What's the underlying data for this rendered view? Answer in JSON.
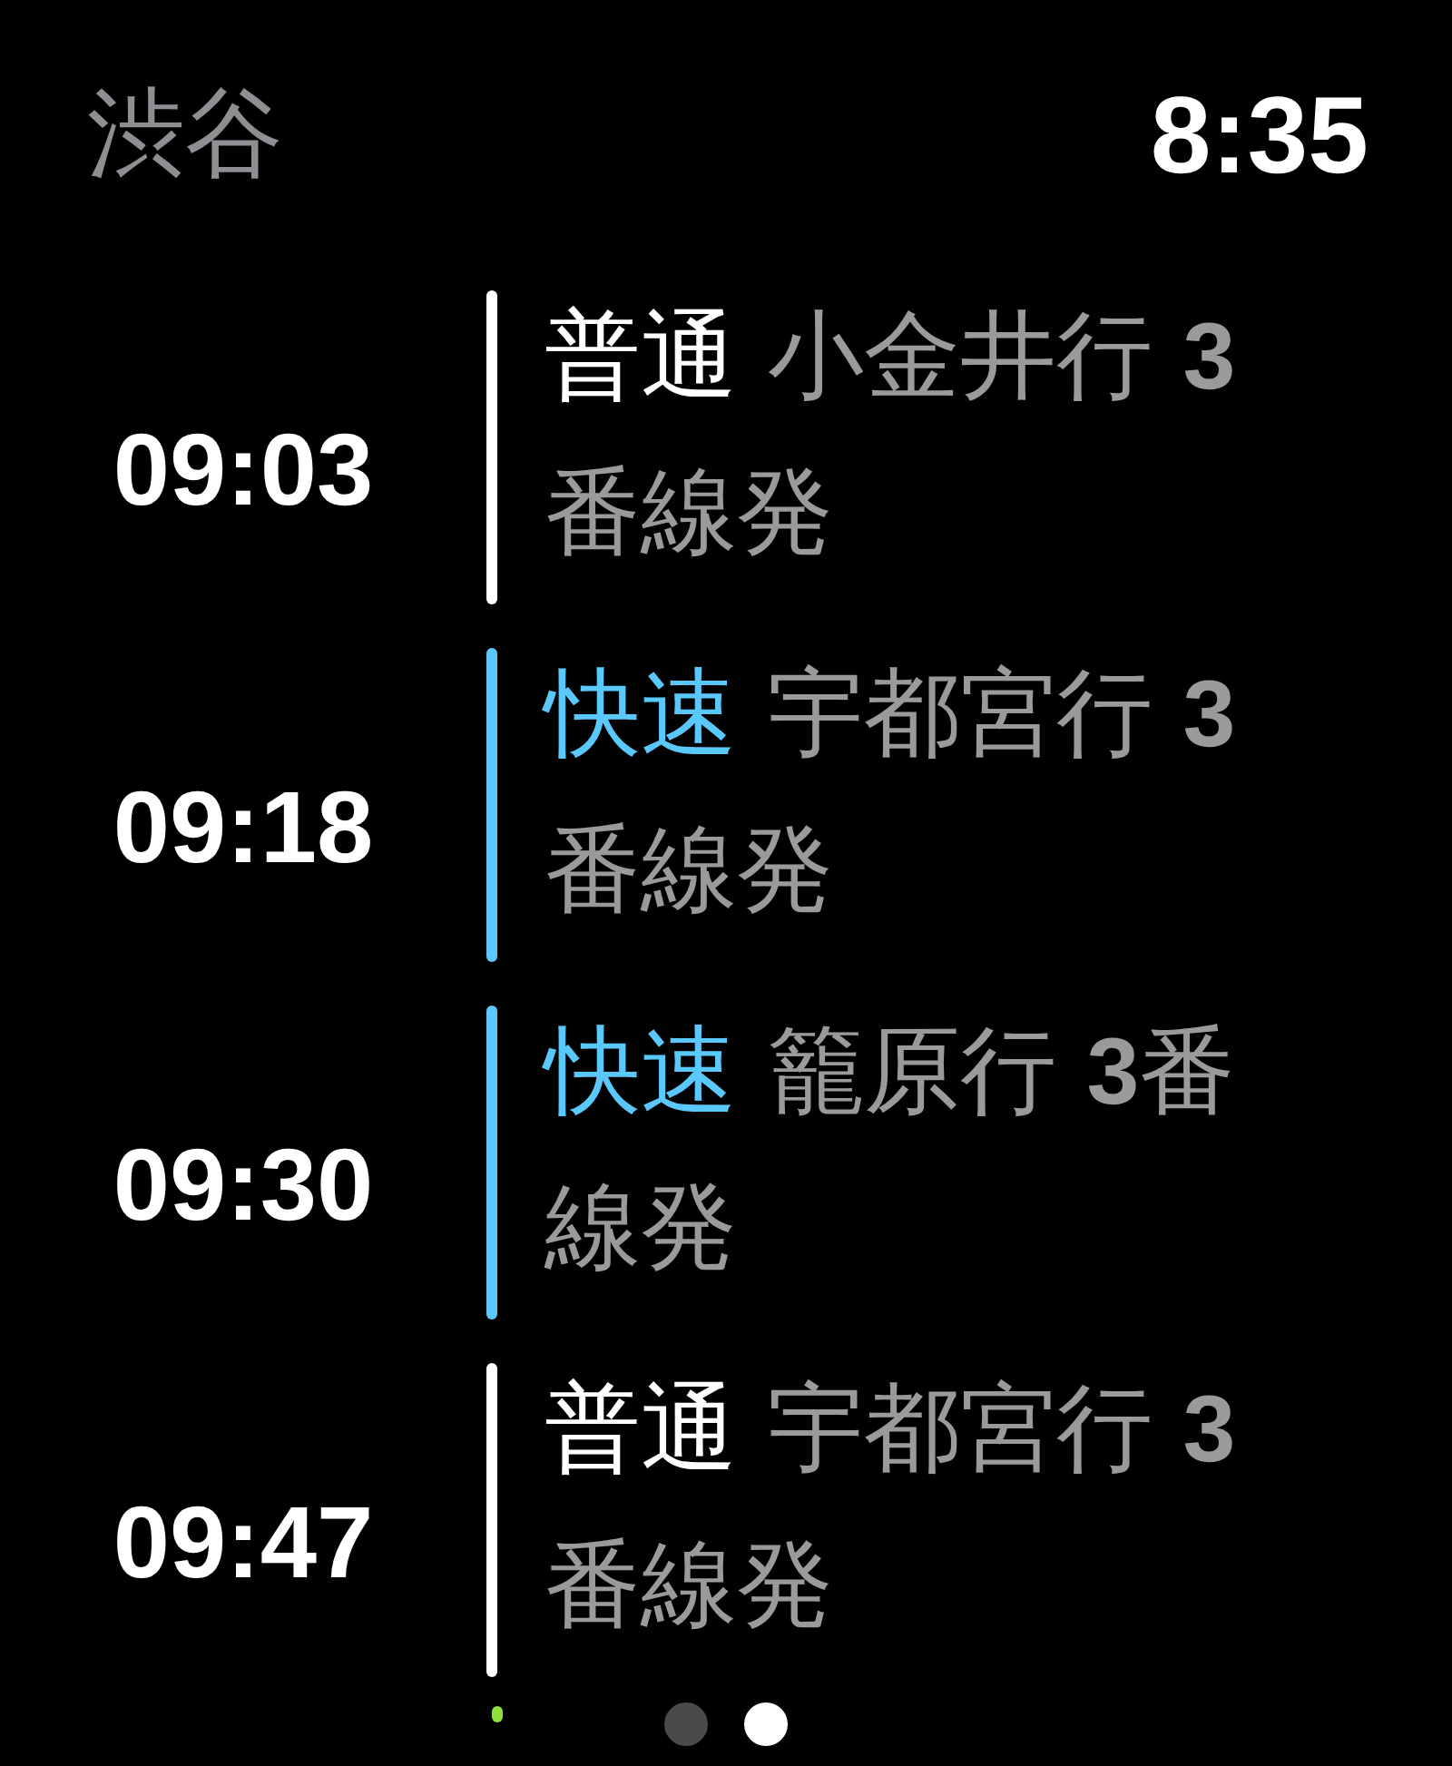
{
  "header": {
    "station": "渋谷",
    "clock": "8:35"
  },
  "departures": [
    {
      "kind": "full",
      "time": "09:03",
      "train_type": "普通",
      "color": "#ffffff",
      "description": "小金井行 **3**番線発"
    },
    {
      "kind": "full",
      "time": "09:18",
      "train_type": "快速",
      "color": "#5ac8fa",
      "description": "宇都宮行 **3**番線発"
    },
    {
      "kind": "full",
      "time": "09:30",
      "train_type": "快速",
      "color": "#5ac8fa",
      "description": "籠原行 **3**番線発"
    },
    {
      "kind": "full",
      "time": "09:47",
      "train_type": "普通",
      "color": "#ffffff",
      "description": "宇都宮行 **3**番線発"
    },
    {
      "kind": "partial",
      "color": "#8ee03a"
    }
  ],
  "pages": [
    {
      "selected": false
    },
    {
      "selected": true
    }
  ]
}
